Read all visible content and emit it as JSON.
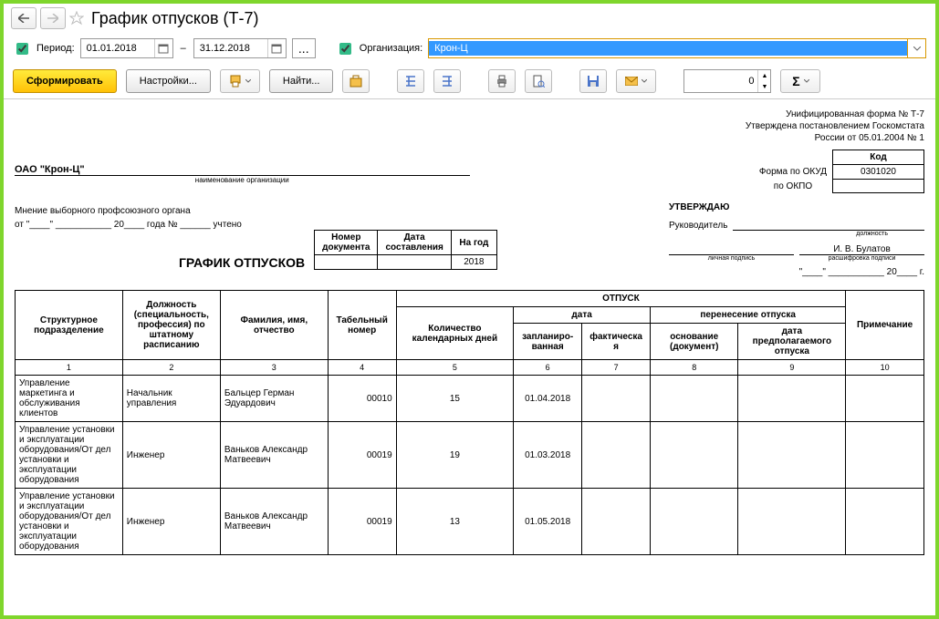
{
  "title": "График отпусков (Т-7)",
  "filter": {
    "period_label": "Период:",
    "date_from": "01.01.2018",
    "date_to": "31.12.2018",
    "org_label": "Организация:",
    "org_value": "Крон-Ц"
  },
  "toolbar": {
    "generate": "Сформировать",
    "settings": "Настройки...",
    "find": "Найти...",
    "spin_value": "0"
  },
  "form_header": {
    "l1": "Унифицированная форма № Т-7",
    "l2": "Утверждена постановлением Госкомстата",
    "l3": "России от 05.01.2004 № 1"
  },
  "codes": {
    "code_hdr": "Код",
    "okud_label": "Форма по ОКУД",
    "okud": "0301020",
    "okpo_label": "по ОКПО",
    "okpo": ""
  },
  "org_name": "ОАО \"Крон-Ц\"",
  "org_sub": "наименование организации",
  "opinion": {
    "l1": "Мнение выборного профсоюзного органа",
    "l2_a": "от \"____\" ___________ 20____ года № ______ учтено"
  },
  "approve": {
    "title": "УТВЕРЖДАЮ",
    "head": "Руководитель",
    "pos_sub": "должность",
    "sign_sub": "личная подпись",
    "name": "И. В. Булатов",
    "name_sub": "расшифровка подписи",
    "date_stub": "\"____\" ___________ 20____ г."
  },
  "doc_title": "ГРАФИК ОТПУСКОВ",
  "doc_meta": {
    "num_h": "Номер\nдокумента",
    "date_h": "Дата\nсоставления",
    "year_h": "На год",
    "num": "",
    "date": "",
    "year": "2018"
  },
  "headers": {
    "dept": "Структурное\nподразделение",
    "position": "Должность\n(специальность,\nпрофессия) по\nштатному\nрасписанию",
    "fio": "Фамилия, имя,\nотчество",
    "tab": "Табельный\nномер",
    "vac": "ОТПУСК",
    "days": "Количество\nкалендарных дней",
    "date": "дата",
    "planned": "запланиро-\nванная",
    "actual": "фактическа\nя",
    "transfer": "перенесение отпуска",
    "basis": "основание\n(документ)",
    "newdate": "дата\nпредполагаемого\nотпуска",
    "note": "Примечание"
  },
  "colnums": [
    "1",
    "2",
    "3",
    "4",
    "5",
    "6",
    "7",
    "8",
    "9",
    "10"
  ],
  "rows": [
    {
      "dept": "Управление маркетинга и обслуживания клиентов",
      "position": "Начальник управления",
      "fio": "Бальцер Герман Эдуардович",
      "tab": "00010",
      "days": "15",
      "planned": "01.04.2018",
      "actual": "",
      "basis": "",
      "newdate": "",
      "note": ""
    },
    {
      "dept": "Управление установки и эксплуатации оборудования/От дел установки и эксплуатации оборудования",
      "position": "Инженер",
      "fio": "Ваньков Александр Матвеевич",
      "tab": "00019",
      "days": "19",
      "planned": "01.03.2018",
      "actual": "",
      "basis": "",
      "newdate": "",
      "note": ""
    },
    {
      "dept": "Управление установки и эксплуатации оборудования/От дел установки и эксплуатации оборудования",
      "position": "Инженер",
      "fio": "Ваньков Александр Матвеевич",
      "tab": "00019",
      "days": "13",
      "planned": "01.05.2018",
      "actual": "",
      "basis": "",
      "newdate": "",
      "note": ""
    }
  ]
}
